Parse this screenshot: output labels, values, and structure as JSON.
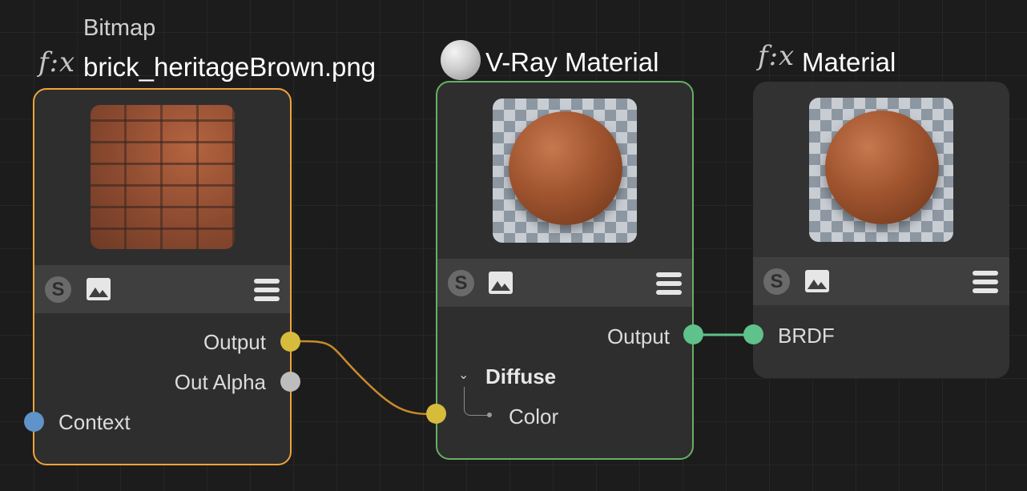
{
  "colors": {
    "background": "#1c1c1c",
    "node_body": "#2e2e2e",
    "toolbar": "#3f3f3f",
    "bitmap_border": "#f2a33a",
    "vray_border": "#67b064",
    "port_color": "#d6bb3c",
    "port_alpha": "#bdbdbd",
    "port_context": "#5f93c9",
    "port_brdf": "#5fc28a",
    "wire_orange": "#c98a2a",
    "wire_green": "#5fc28a"
  },
  "bitmap_node": {
    "type_label": "Bitmap",
    "title": "brick_heritageBrown.png",
    "fx_icon": "f:x",
    "thumbnail": "brick-texture-preview",
    "toolbar": {
      "s_icon": "S",
      "image_icon": "image-icon",
      "menu_icon": "menu-icon"
    },
    "outputs": [
      "Output",
      "Out Alpha"
    ],
    "inputs": [
      "Context"
    ]
  },
  "vray_node": {
    "title": "V-Ray Material",
    "icon": "sphere-icon",
    "thumbnail": "brick-sphere-preview",
    "toolbar": {
      "s_icon": "S",
      "image_icon": "image-icon",
      "menu_icon": "menu-icon"
    },
    "outputs": [
      "Output"
    ],
    "group_label": "Diffuse",
    "group_inputs": [
      "Color"
    ]
  },
  "material_node": {
    "title": "Material",
    "fx_icon": "f:x",
    "thumbnail": "brick-sphere-preview",
    "toolbar": {
      "s_icon": "S",
      "image_icon": "image-icon",
      "menu_icon": "menu-icon"
    },
    "inputs": [
      "BRDF"
    ]
  }
}
